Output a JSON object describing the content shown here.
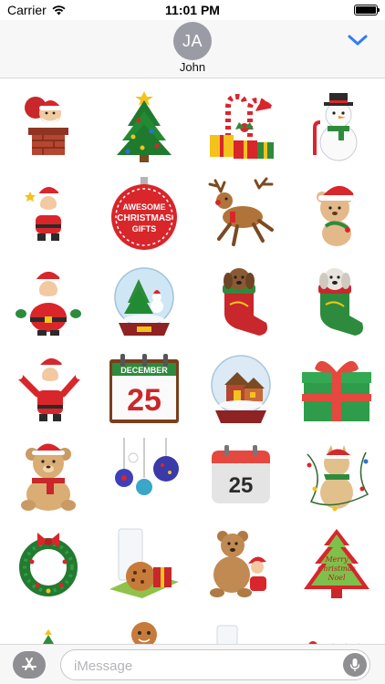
{
  "status_bar": {
    "carrier": "Carrier",
    "time": "11:01 PM"
  },
  "header": {
    "avatar_initials": "JA",
    "contact_name": "John"
  },
  "stickers": [
    {
      "name": "santa-chimney"
    },
    {
      "name": "christmas-tree"
    },
    {
      "name": "candy-canes-gifts"
    },
    {
      "name": "snowman"
    },
    {
      "name": "small-santa"
    },
    {
      "name": "awesome-christmas-gifts-ornament",
      "text": [
        "AWESOME",
        "CHRISTMAS",
        "GIFTS"
      ]
    },
    {
      "name": "reindeer"
    },
    {
      "name": "teddy-bear-santa-hat"
    },
    {
      "name": "santa-standing"
    },
    {
      "name": "snow-globe-tree"
    },
    {
      "name": "puppy-stocking-red"
    },
    {
      "name": "puppy-stocking-green"
    },
    {
      "name": "santa-waving"
    },
    {
      "name": "december-25-calendar",
      "text": [
        "DECEMBER",
        "25"
      ]
    },
    {
      "name": "snow-globe-house"
    },
    {
      "name": "green-gift-box"
    },
    {
      "name": "teddy-bear-scarf"
    },
    {
      "name": "ornaments"
    },
    {
      "name": "calendar-25",
      "text": [
        "25"
      ]
    },
    {
      "name": "cat-with-lights"
    },
    {
      "name": "wreath"
    },
    {
      "name": "milk-and-cookies"
    },
    {
      "name": "bear-with-santa"
    },
    {
      "name": "merry-christmas-tree-cookie",
      "text": [
        "Merry",
        "Christmas",
        "Noel"
      ]
    },
    {
      "name": "small-tree"
    },
    {
      "name": "gingerbread-man"
    },
    {
      "name": "milk-glass-gift"
    },
    {
      "name": "santa-sleigh"
    }
  ],
  "input": {
    "placeholder": "iMessage"
  },
  "colors": {
    "accent": "#2f7cf6",
    "avatar": "#9b9ba5",
    "bar": "#f7f7f7"
  }
}
